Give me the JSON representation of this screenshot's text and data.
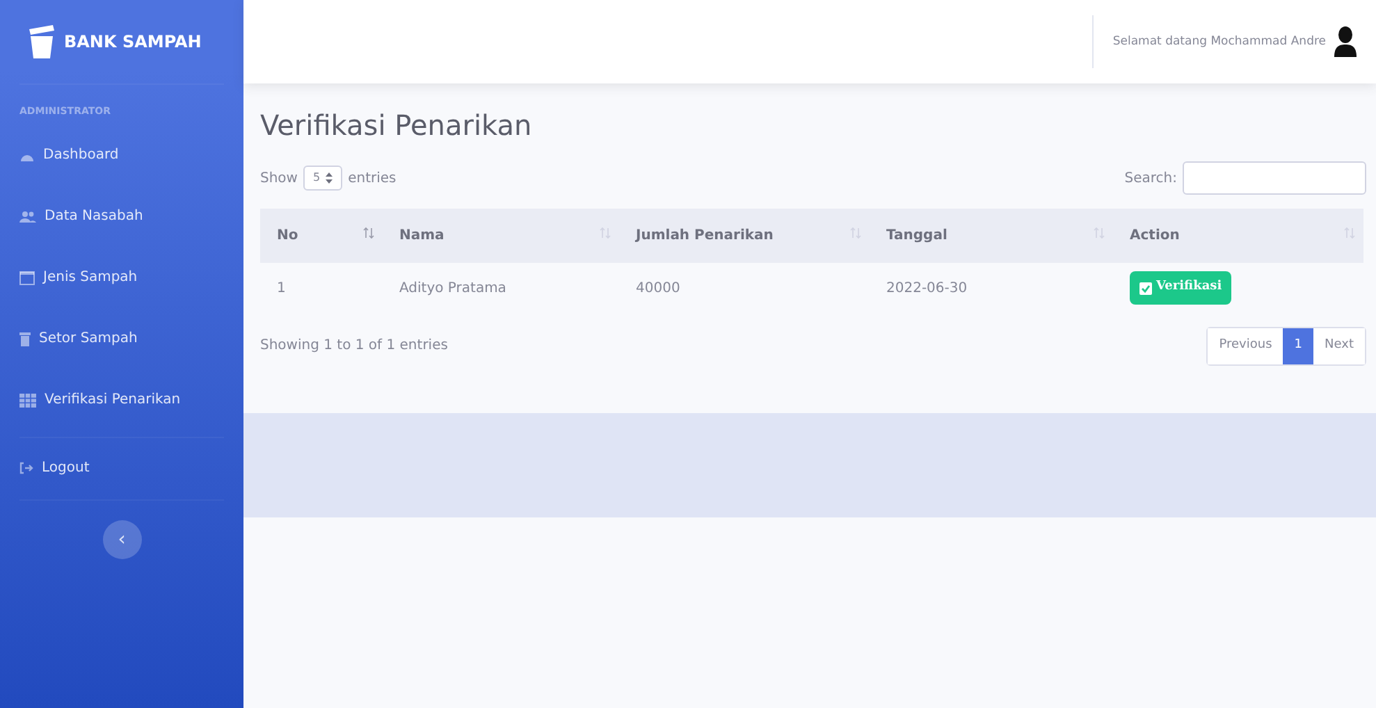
{
  "sidebar": {
    "brand": "BANK SAMPAH",
    "heading": "ADMINISTRATOR",
    "items": [
      {
        "label": "Dashboard",
        "selected": false
      },
      {
        "label": "Data Nasabah",
        "selected": false
      },
      {
        "label": "Jenis Sampah",
        "selected": false
      },
      {
        "label": "Setor Sampah",
        "selected": false
      },
      {
        "label": "Verifikasi Penarikan",
        "selected": false
      }
    ],
    "logout": "Logout",
    "toggle": "‹"
  },
  "topbar": {
    "greeting": "Selamat datang Mochammad Andre"
  },
  "page": {
    "title": "Verifikasi Penarikan",
    "length": {
      "before": "Show",
      "value": "5",
      "after": "entries"
    },
    "search_label": "Search:",
    "columns": [
      "No",
      "Nama",
      "Jumlah Penarikan",
      "Tanggal",
      "Action"
    ],
    "rows": [
      {
        "no": "1",
        "nama": "Adityo Pratama",
        "jumlah": "40000",
        "tanggal": "2022-06-30",
        "action": "Verifikasi"
      }
    ],
    "info": "Showing 1 to 1 of 1 entries",
    "pagination": [
      {
        "label": "Previous",
        "selected": false
      },
      {
        "label": "1",
        "selected": true
      },
      {
        "label": "Next",
        "selected": false
      }
    ]
  }
}
